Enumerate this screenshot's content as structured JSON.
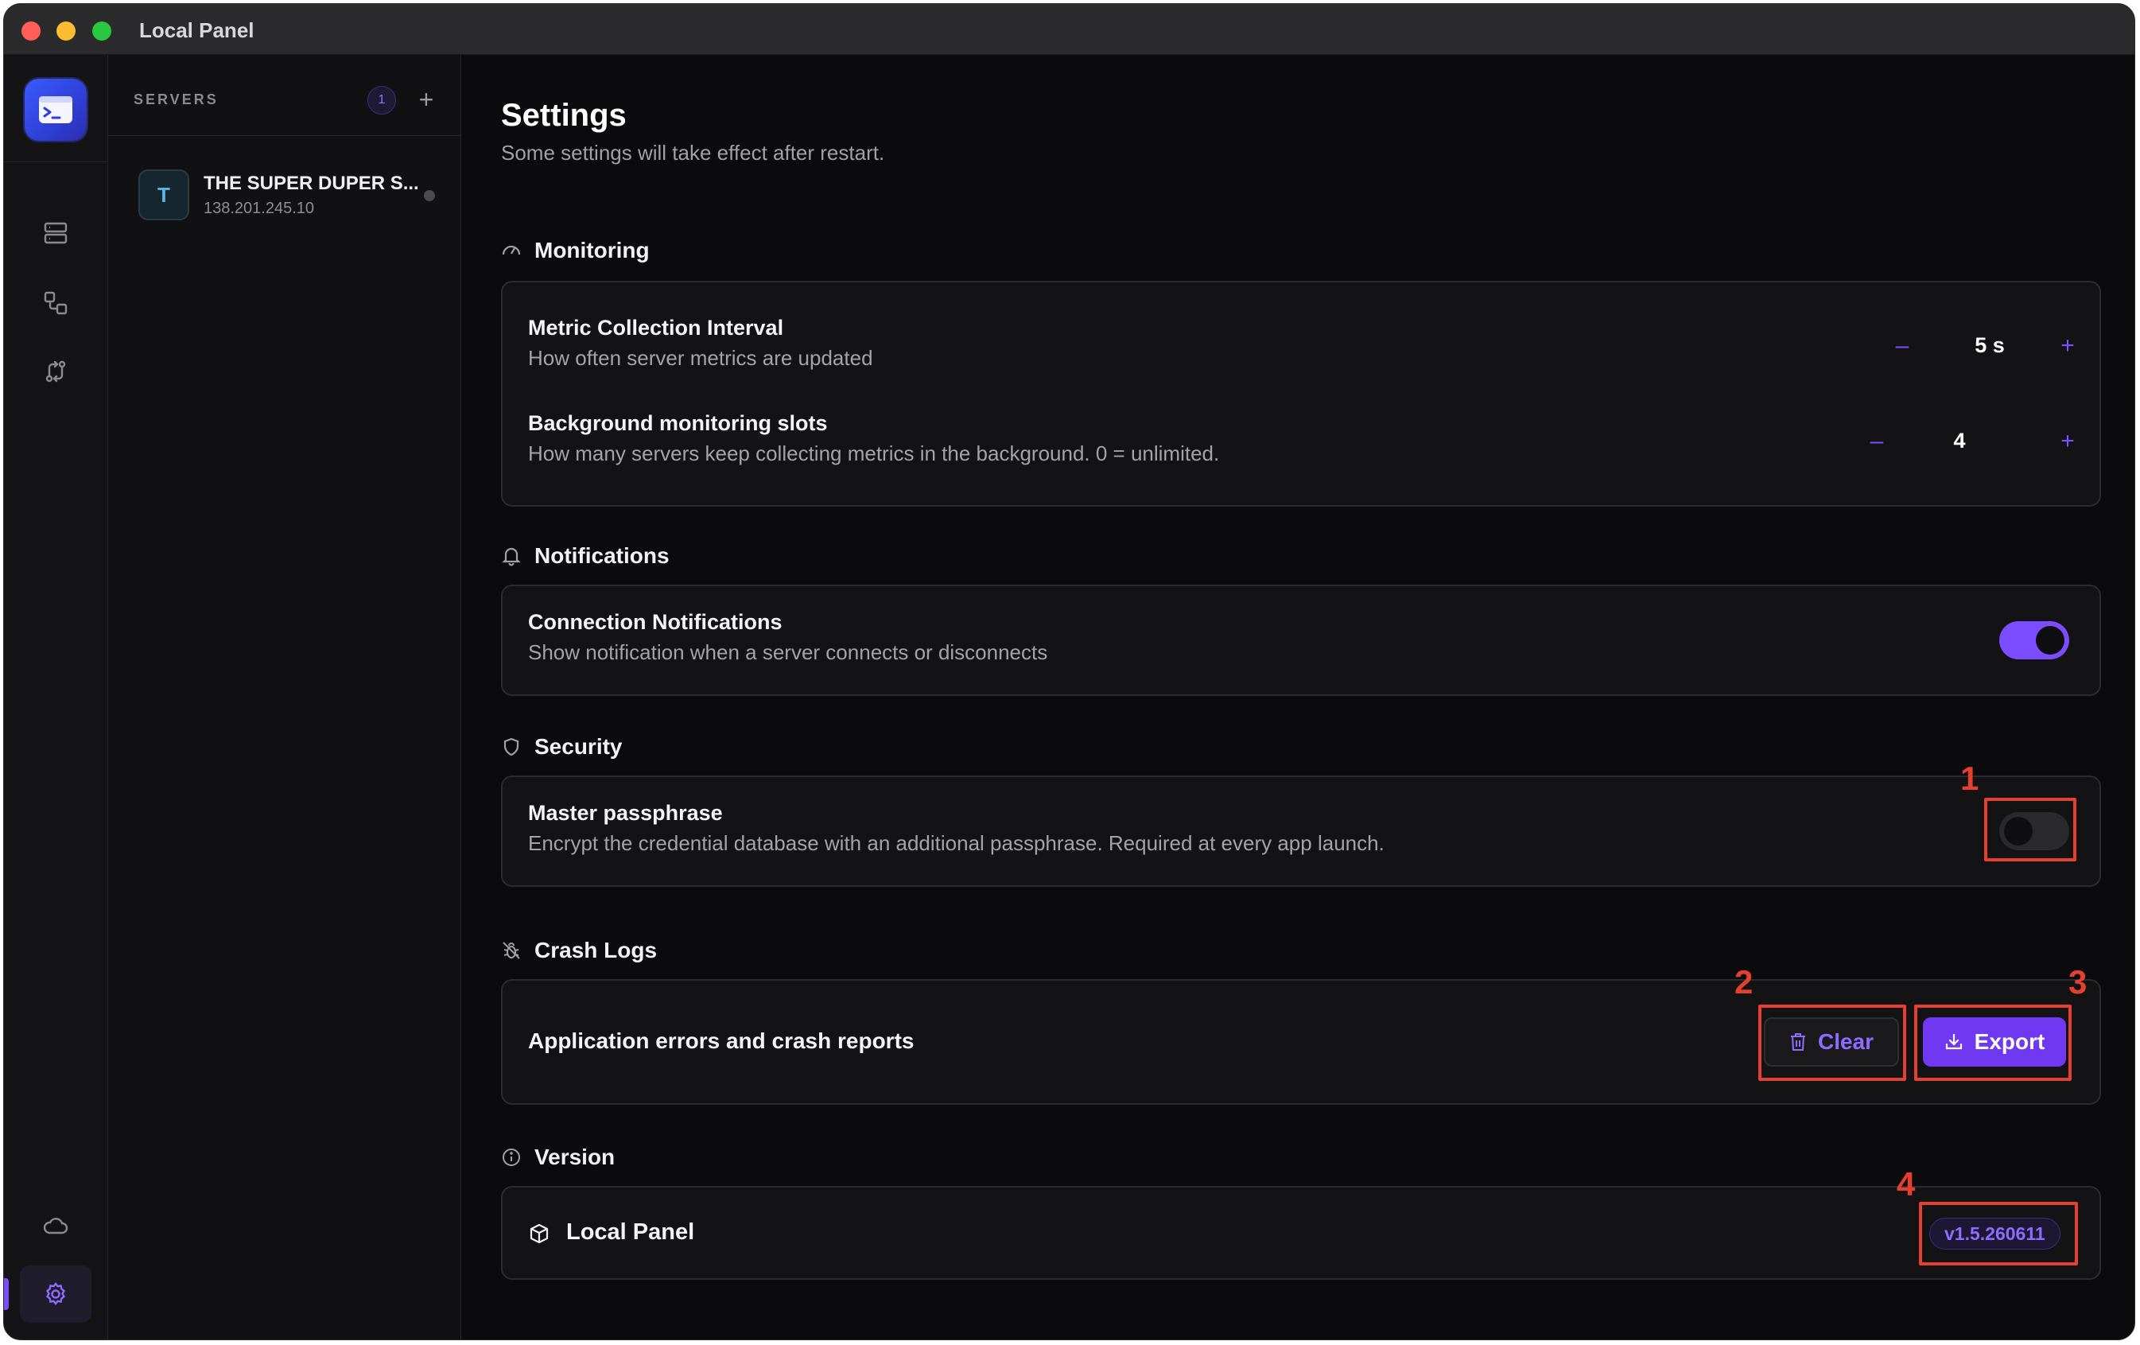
{
  "window": {
    "title": "Local Panel"
  },
  "rail": {
    "items": [
      "servers-icon",
      "connections-icon",
      "transfer-icon"
    ],
    "bottom_items": [
      "cloud-icon",
      "gear-icon"
    ]
  },
  "servers": {
    "title": "SERVERS",
    "count": "1",
    "add_label": "+",
    "items": [
      {
        "avatar": "T",
        "name": "THE SUPER DUPER S...",
        "ip": "138.201.245.10",
        "status": "offline"
      }
    ]
  },
  "settings": {
    "title": "Settings",
    "subtitle": "Some settings will take effect after restart.",
    "monitoring": {
      "label": "Monitoring",
      "interval": {
        "title": "Metric Collection Interval",
        "desc": "How often server metrics are updated",
        "value": "5 s",
        "minus": "–",
        "plus": "+"
      },
      "slots": {
        "title": "Background monitoring slots",
        "desc": "How many servers keep collecting metrics in the background. 0 = unlimited.",
        "value": "4",
        "minus": "–",
        "plus": "+"
      }
    },
    "notifications": {
      "label": "Notifications",
      "connection": {
        "title": "Connection Notifications",
        "desc": "Show notification when a server connects or disconnects",
        "enabled": true
      }
    },
    "security": {
      "label": "Security",
      "passphrase": {
        "title": "Master passphrase",
        "desc": "Encrypt the credential database with an additional passphrase. Required at every app launch.",
        "enabled": false
      }
    },
    "crash_logs": {
      "label": "Crash Logs",
      "row_title": "Application errors and crash reports",
      "clear_label": "Clear",
      "export_label": "Export"
    },
    "version": {
      "label": "Version",
      "app_name": "Local Panel",
      "value": "v1.5.260611"
    }
  },
  "annotations": [
    "1",
    "2",
    "3",
    "4"
  ],
  "colors": {
    "accent": "#7c4dff",
    "annotation": "#e5402f"
  }
}
